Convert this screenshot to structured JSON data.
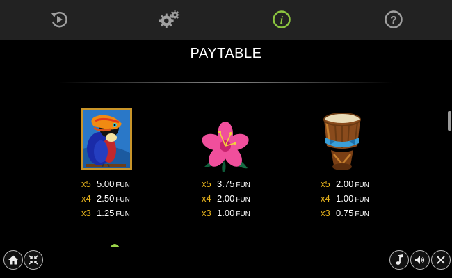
{
  "topbar": {
    "icons": [
      "replay-icon",
      "settings-icon",
      "info-icon",
      "help-icon"
    ],
    "active": "info-icon",
    "active_color": "#8cc63f"
  },
  "title": "PAYTABLE",
  "symbols": [
    {
      "name": "toucan",
      "pays": [
        {
          "mult": "x5",
          "value": "5.00",
          "unit": "FUN"
        },
        {
          "mult": "x4",
          "value": "2.50",
          "unit": "FUN"
        },
        {
          "mult": "x3",
          "value": "1.25",
          "unit": "FUN"
        }
      ]
    },
    {
      "name": "flower",
      "pays": [
        {
          "mult": "x5",
          "value": "3.75",
          "unit": "FUN"
        },
        {
          "mult": "x4",
          "value": "2.00",
          "unit": "FUN"
        },
        {
          "mult": "x3",
          "value": "1.00",
          "unit": "FUN"
        }
      ]
    },
    {
      "name": "drum",
      "pays": [
        {
          "mult": "x5",
          "value": "2.00",
          "unit": "FUN"
        },
        {
          "mult": "x4",
          "value": "1.00",
          "unit": "FUN"
        },
        {
          "mult": "x3",
          "value": "0.75",
          "unit": "FUN"
        }
      ]
    }
  ],
  "bottom_left": [
    "home-icon",
    "fullscreen-icon"
  ],
  "bottom_right": [
    "music-icon",
    "sound-icon",
    "close-icon"
  ],
  "colors": {
    "multiplier": "#e8b41c",
    "topbar": "#222222"
  }
}
